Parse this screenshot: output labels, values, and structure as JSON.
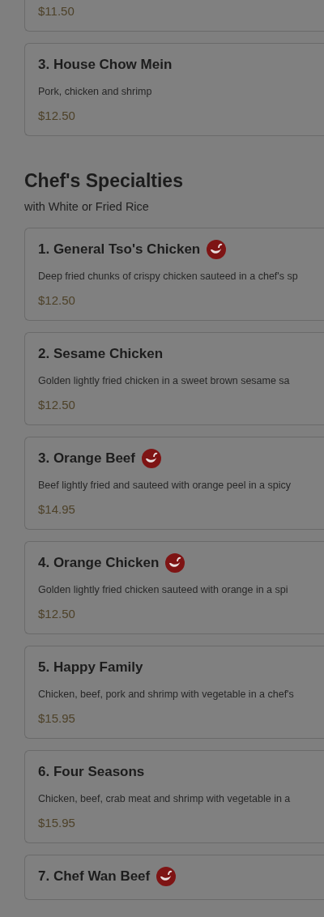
{
  "previous_section": {
    "items": [
      {
        "price": "$11.50",
        "spicy": false
      },
      {
        "name": "3. House Chow Mein",
        "description": "Pork, chicken and shrimp",
        "price": "$12.50",
        "spicy": false
      }
    ]
  },
  "section": {
    "title": "Chef's Specialties",
    "subtitle": "with White or Fried Rice",
    "items": [
      {
        "name": "1. General Tso's Chicken",
        "description": "Deep fried chunks of crispy chicken sauteed in a chef's sp",
        "price": "$12.50",
        "spicy": true
      },
      {
        "name": "2. Sesame Chicken",
        "description": "Golden lightly fried chicken in a sweet brown sesame sa",
        "price": "$12.50",
        "spicy": false
      },
      {
        "name": "3. Orange Beef",
        "description": "Beef lightly fried and sauteed with orange peel in a spicy",
        "price": "$14.95",
        "spicy": true
      },
      {
        "name": "4. Orange Chicken",
        "description": "Golden lightly fried chicken sauteed with orange in a spi",
        "price": "$12.50",
        "spicy": true
      },
      {
        "name": "5. Happy Family",
        "description": "Chicken, beef, pork and shrimp with vegetable in a chef's",
        "price": "$15.95",
        "spicy": false
      },
      {
        "name": "6. Four Seasons",
        "description": "Chicken, beef, crab meat and shrimp with vegetable in a",
        "price": "$15.95",
        "spicy": false
      },
      {
        "name": "7. Chef Wan Beef",
        "spicy": true
      }
    ]
  }
}
